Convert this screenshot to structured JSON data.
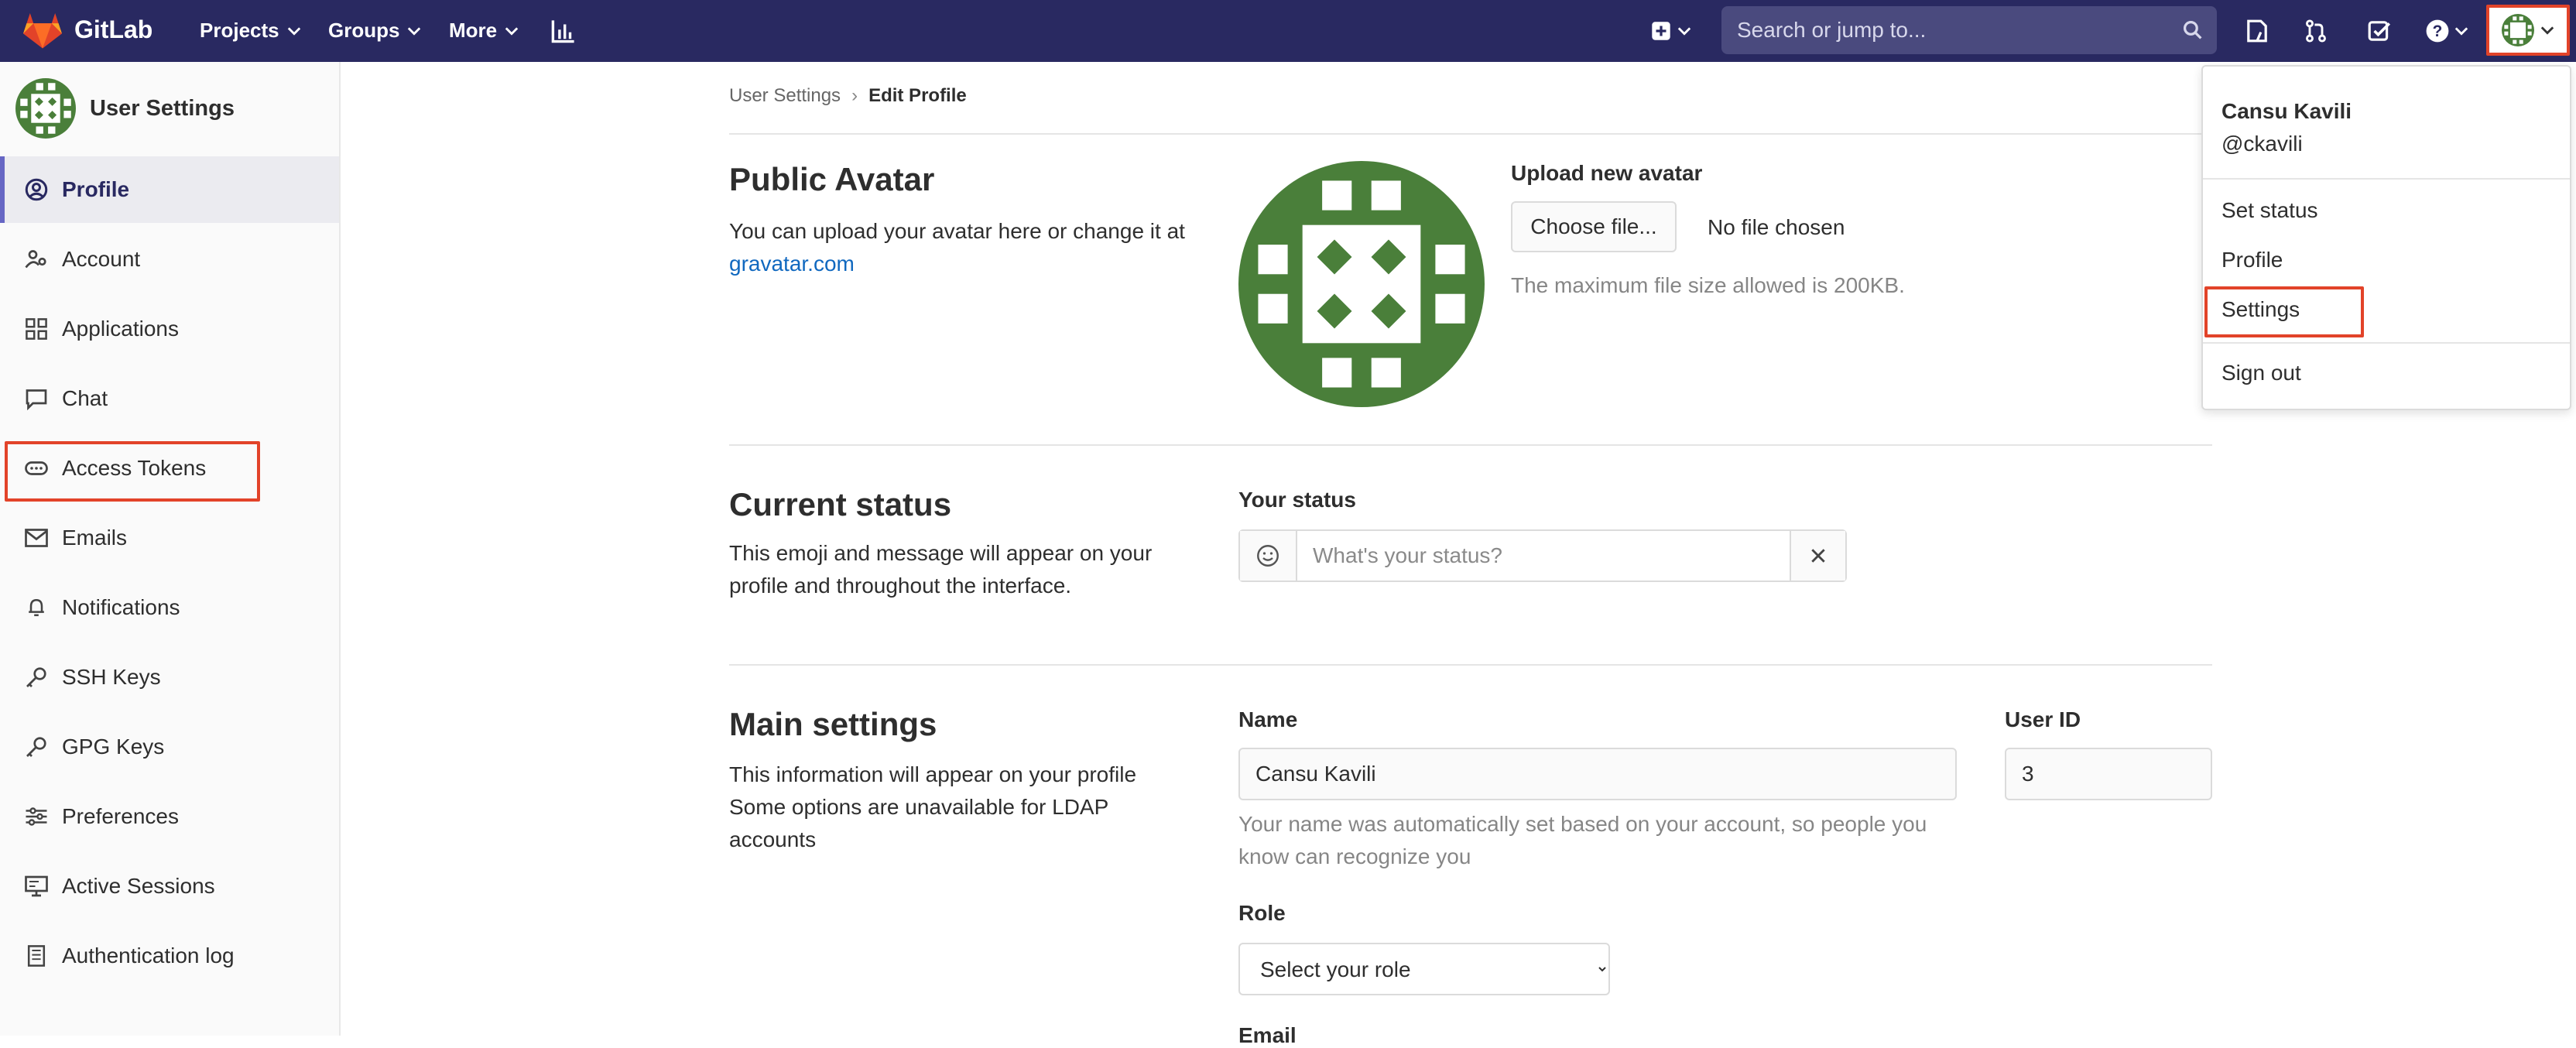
{
  "colors": {
    "navbar": "#292961",
    "accent": "#6666c4",
    "highlight": "#e24329",
    "avatar_green": "#4a7f3a",
    "link": "#1068bf"
  },
  "navbar": {
    "brand": "GitLab",
    "menus": [
      {
        "label": "Projects"
      },
      {
        "label": "Groups"
      },
      {
        "label": "More"
      }
    ],
    "search_placeholder": "Search or jump to...",
    "icons": [
      "activity-chart-icon",
      "plus-square-icon",
      "search-icon",
      "issues-icon",
      "merge-request-icon",
      "todo-check-icon",
      "help-icon",
      "avatar-icon"
    ]
  },
  "sidebar": {
    "title": "User Settings",
    "items": [
      {
        "label": "Profile",
        "icon": "profile-icon",
        "active": true
      },
      {
        "label": "Account",
        "icon": "account-icon"
      },
      {
        "label": "Applications",
        "icon": "applications-icon"
      },
      {
        "label": "Chat",
        "icon": "chat-icon"
      },
      {
        "label": "Access Tokens",
        "icon": "token-icon",
        "highlighted": true
      },
      {
        "label": "Emails",
        "icon": "mail-icon"
      },
      {
        "label": "Notifications",
        "icon": "bell-icon"
      },
      {
        "label": "SSH Keys",
        "icon": "key-icon"
      },
      {
        "label": "GPG Keys",
        "icon": "key-icon"
      },
      {
        "label": "Preferences",
        "icon": "preferences-icon"
      },
      {
        "label": "Active Sessions",
        "icon": "monitor-icon"
      },
      {
        "label": "Authentication log",
        "icon": "log-icon"
      }
    ]
  },
  "breadcrumb": {
    "parent": "User Settings",
    "current": "Edit Profile"
  },
  "avatar_section": {
    "title": "Public Avatar",
    "desc_prefix": "You can upload your avatar here or change it at",
    "gravatar_link": "gravatar.com",
    "upload_label": "Upload new avatar",
    "choose_button": "Choose file...",
    "no_file": "No file chosen",
    "max_size_help": "The maximum file size allowed is 200KB."
  },
  "status_section": {
    "title": "Current status",
    "desc": "This emoji and message will appear on your profile and throughout the interface.",
    "label": "Your status",
    "placeholder": "What's your status?"
  },
  "main_settings": {
    "title": "Main settings",
    "desc_line1": "This information will appear on your profile",
    "desc_line2": "Some options are unavailable for LDAP accounts",
    "name_label": "Name",
    "name_value": "Cansu Kavili",
    "name_help": "Your name was automatically set based on your account, so people you know can recognize you",
    "userid_label": "User ID",
    "userid_value": "3",
    "role_label": "Role",
    "role_selected": "Select your role",
    "email_label": "Email"
  },
  "user_dropdown": {
    "name": "Cansu Kavili",
    "username": "@ckavili",
    "items": [
      {
        "label": "Set status"
      },
      {
        "label": "Profile"
      },
      {
        "label": "Settings",
        "highlighted": true
      },
      {
        "label": "Sign out"
      }
    ]
  }
}
